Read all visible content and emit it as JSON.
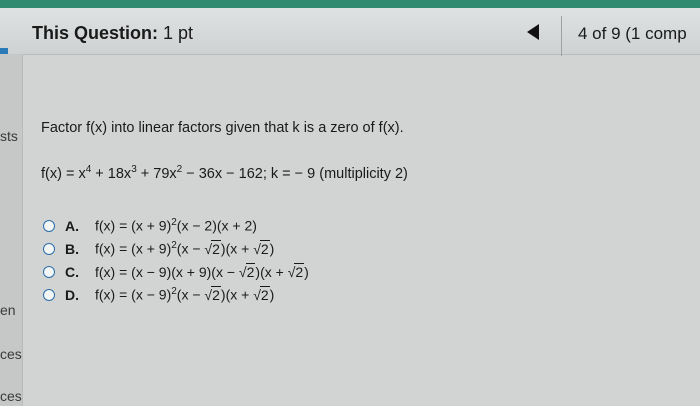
{
  "header": {
    "title_label": "This Question:",
    "title_value": "1 pt",
    "progress": "4 of 9 (1 comp"
  },
  "sidebar": {
    "fragments": [
      "sts",
      "en",
      "ces",
      "ces"
    ]
  },
  "question": {
    "prompt": "Factor f(x) into linear factors given that k is a zero of f(x).",
    "func_lead": "f(x) = x",
    "func_e1": "4",
    "func_t2": " + 18x",
    "func_e2": "3",
    "func_t3": " + 79x",
    "func_e3": "2",
    "func_t4": " − 36x − 162; k = − 9 (multiplicity 2)"
  },
  "options": [
    {
      "letter": "A.",
      "p1": "f(x) = (x + 9)",
      "sup": "2",
      "p2": "(x − 2)(x + 2)"
    },
    {
      "letter": "B.",
      "p1": "f(x) = (x + 9)",
      "sup": "2",
      "p2": "(x − ",
      "r1": "2",
      "p3": ")(x + ",
      "r2": "2",
      "p4": ")"
    },
    {
      "letter": "C.",
      "p1": "f(x) = (x − 9)(x + 9)(x − ",
      "r1": "2",
      "p3": ")(x + ",
      "r2": "2",
      "p4": ")"
    },
    {
      "letter": "D.",
      "p1": "f(x) = (x − 9)",
      "sup": "2",
      "p2": "(x − ",
      "r1": "2",
      "p3": ")(x + ",
      "r2": "2",
      "p4": ")"
    }
  ],
  "colors": {
    "accent": "#2f8a6f",
    "radio": "#2a6ea8"
  }
}
